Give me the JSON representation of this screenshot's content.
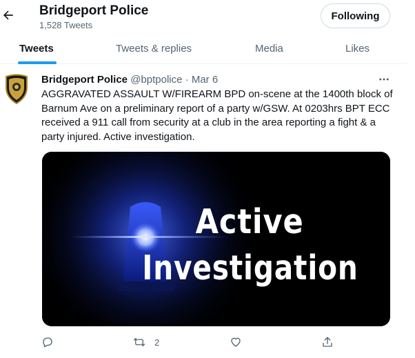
{
  "profile": {
    "name": "Bridgeport Police",
    "tweet_count": "1,528 Tweets",
    "follow_label": "Following"
  },
  "tabs": [
    {
      "label": "Tweets",
      "active": true
    },
    {
      "label": "Tweets & replies",
      "active": false
    },
    {
      "label": "Media",
      "active": false
    },
    {
      "label": "Likes",
      "active": false
    }
  ],
  "tweet": {
    "author_name": "Bridgeport Police",
    "handle": "@bptpolice",
    "separator": "·",
    "date": "Mar 6",
    "text": "AGGRAVATED ASSAULT W/FIREARM BPD on-scene at the 1400th block of Barnum Ave on a preliminary report of a party w/GSW. At 0203hrs BPT ECC received a 911 call from security at a club in the area reporting a fight & a party injured. Active investigation.",
    "media": {
      "line1": "Active",
      "line2": "Investigation"
    },
    "retweet_count": "2"
  },
  "icons": {
    "back": "arrow-left-icon",
    "more": "more-horizontal-icon",
    "reply": "reply-icon",
    "retweet": "retweet-icon",
    "like": "heart-icon",
    "share": "share-icon"
  },
  "colors": {
    "accent": "#1d9bf0",
    "text": "#0f1419",
    "secondary": "#536471",
    "border": "#cfd9de"
  }
}
